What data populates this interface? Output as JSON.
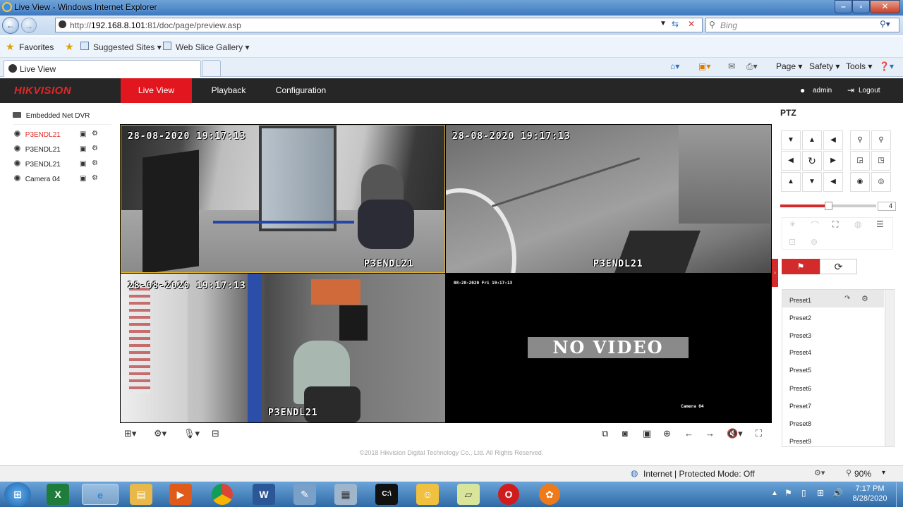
{
  "window": {
    "title": "Live View - Windows Internet Explorer"
  },
  "browser": {
    "address_prefix": "http://",
    "address_host": "192.168.8.101",
    "address_rest": ":81/doc/page/preview.asp",
    "search_placeholder": "Bing",
    "favorites_label": "Favorites",
    "suggested_sites": "Suggested Sites ▾",
    "web_slice_gallery": "Web Slice Gallery ▾",
    "tab_label": "Live View",
    "commands": {
      "page": "Page ▾",
      "safety": "Safety ▾",
      "tools": "Tools ▾"
    }
  },
  "app": {
    "logo": "HIKVISION",
    "nav": {
      "live_view": "Live View",
      "playback": "Playback",
      "configuration": "Configuration"
    },
    "user": "admin",
    "logout": "Logout",
    "device_name": "Embedded Net DVR",
    "cameras": [
      {
        "label": "P3ENDL21",
        "active": true
      },
      {
        "label": "P3ENDL21",
        "active": false
      },
      {
        "label": "P3ENDL21",
        "active": false
      },
      {
        "label": "Camera 04",
        "active": false
      }
    ],
    "tiles": [
      {
        "timestamp": "28-08-2020 19:17:13",
        "name": "P3ENDL21"
      },
      {
        "timestamp": "28-08-2020 19:17:13",
        "name": "P3ENDL21"
      },
      {
        "timestamp": "28-08-2020 19:17:13",
        "name": "P3ENDL21"
      },
      {
        "timestamp": "08-28-2020 Fri 19:17:13",
        "name": "Camera 04",
        "no_video": "NO VIDEO"
      }
    ],
    "footer": "©2018 Hikvision Digital Technology Co., Ltd. All Rights Reserved.",
    "ptz": {
      "title": "PTZ",
      "speed": "4",
      "speed_fraction": 0.5,
      "presets": [
        "Preset1",
        "Preset2",
        "Preset3",
        "Preset4",
        "Preset5",
        "Preset6",
        "Preset7",
        "Preset8",
        "Preset9"
      ]
    }
  },
  "statusbar": {
    "zone": "Internet | Protected Mode: Off",
    "zoom": "90%"
  },
  "taskbar": {
    "time": "7:17 PM",
    "date": "8/28/2020"
  },
  "colors": {
    "accent": "#e2161e",
    "header_bg": "#262626"
  }
}
